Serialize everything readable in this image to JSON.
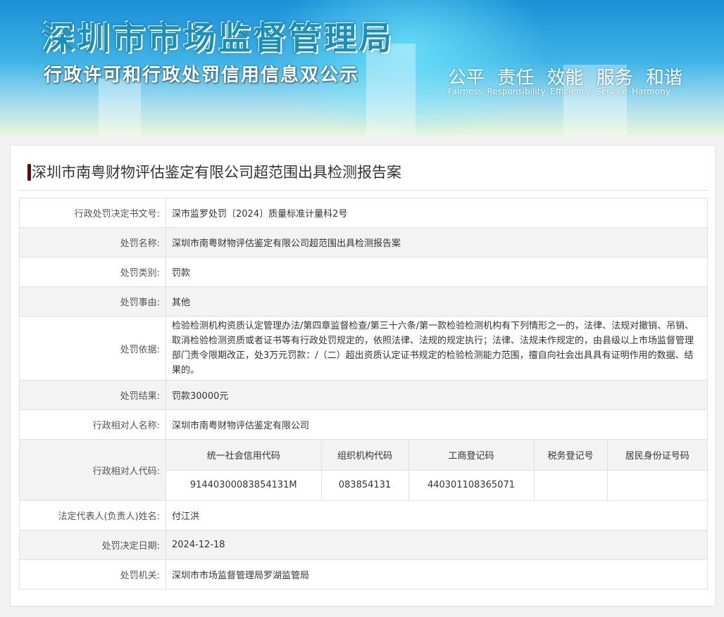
{
  "banner": {
    "title": "深圳市市场监督管理局",
    "subtitle": "行政许可和行政处罚信用信息双公示",
    "slogan": "公平 责任 效能 服务 和谐",
    "slogan_en": "Fairness Responsibility Efficiency Service Harmony"
  },
  "case_title": "深圳市南粤财物评估鉴定有限公司超范围出具检测报告案",
  "rows": [
    {
      "label": "行政处罚决定书文号:",
      "value": "深市监罗处罚〔2024〕质量标准计量科2号"
    },
    {
      "label": "处罚名称:",
      "value": "深圳市南粤财物评估鉴定有限公司超范围出具检测报告案"
    },
    {
      "label": "处罚类别:",
      "value": "罚款"
    },
    {
      "label": "处罚事由:",
      "value": "其他"
    },
    {
      "label": "处罚依据:",
      "value": "检验检测机构资质认定管理办法/第四章监督检查/第三十六条/第一款检验检测机构有下列情形之一的，法律、法规对撤销、吊销、取消检验检测资质或者证书等有行政处罚规定的，依照法律、法规的规定执行；法律、法规未作规定的，由县级以上市场监督管理部门责令限期改正，处3万元罚款：/（二）超出资质认定证书规定的检验检测能力范围，擅自向社会出具具有证明作用的数据、结果的。"
    },
    {
      "label": "处罚结果:",
      "value": "罚款30000元"
    },
    {
      "label": "行政相对人名称:",
      "value": "深圳市南粤财物评估鉴定有限公司"
    }
  ],
  "codes": {
    "label": "行政相对人代码:",
    "headers": [
      "统一社会信用代码",
      "组织机构代码",
      "工商登记码",
      "税务登记号",
      "居民身份证号码"
    ],
    "values": [
      "91440300083854131M",
      "083854131",
      "440301108365071",
      "",
      ""
    ]
  },
  "rows2": [
    {
      "label": "法定代表人(负责人)姓名:",
      "value": "付江洪"
    },
    {
      "label": "处罚决定日期:",
      "value": "2024-12-18"
    },
    {
      "label": "处罚机关:",
      "value": "深圳市市场监督管理局罗湖监管局"
    }
  ]
}
